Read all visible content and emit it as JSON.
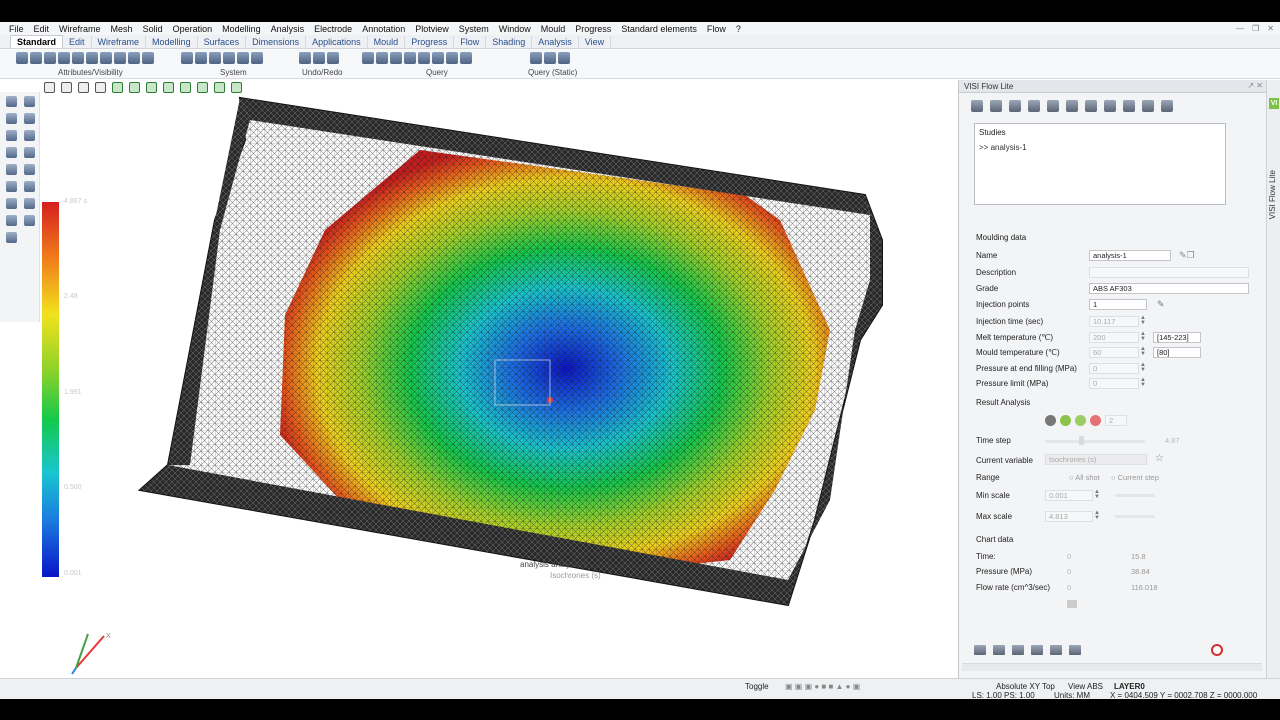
{
  "menu": [
    "File",
    "Edit",
    "Wireframe",
    "Mesh",
    "Solid",
    "Operation",
    "Modelling",
    "Analysis",
    "Electrode",
    "Annotation",
    "Plotview",
    "System",
    "Window",
    "Mould",
    "Progress",
    "Standard elements",
    "Flow",
    "?"
  ],
  "tabs": [
    "Standard",
    "Edit",
    "Wireframe",
    "Modelling",
    "Surfaces",
    "Dimensions",
    "Applications",
    "Mould",
    "Progress",
    "Flow",
    "Shading",
    "Analysis",
    "View"
  ],
  "active_tab": "Standard",
  "ribbon_groups": [
    "Attributes/Visibility",
    "System",
    "Undo/Redo",
    "Query",
    "Query (Static)"
  ],
  "viewport": {
    "legend_ticks": [
      "4.867 s",
      "2.48",
      "1.991",
      "0.500",
      "0.001"
    ],
    "overlay_text": "analysis   analysis-1",
    "overlay_text2": "Isochrones (s)"
  },
  "panel": {
    "title": "VISI Flow Lite",
    "studies_header": "Studies",
    "study_item": ">> analysis-1",
    "moulding_header": "Moulding data",
    "fields": [
      {
        "label": "Name",
        "value": "analysis-1"
      },
      {
        "label": "Description",
        "value": ""
      },
      {
        "label": "Grade",
        "value": "ABS AF303"
      },
      {
        "label": "Injection points",
        "value": "1"
      },
      {
        "label": "Injection time (sec)",
        "value": "10.117"
      },
      {
        "label": "Melt temperature (℃)",
        "value": "200",
        "range": "[145-223]"
      },
      {
        "label": "Mould temperature (℃)",
        "value": "60",
        "range": "[80]"
      },
      {
        "label": "Pressure at end filling (MPa)",
        "value": "0"
      },
      {
        "label": "Pressure limit (MPa)",
        "value": "0"
      }
    ],
    "result_header": "Result Analysis",
    "result_count": "2",
    "time_step_label": "Time step",
    "time_step_value": "4.87",
    "current_variable_label": "Current variable",
    "current_variable_value": "Isochrones (s)",
    "range_label": "Range",
    "range_all": "All shot",
    "range_current": "Current step",
    "min_scale_label": "Min scale",
    "min_scale_value": "0.001",
    "max_scale_label": "Max scale",
    "max_scale_value": "4.813",
    "chart_header": "Chart data",
    "chart_rows": [
      {
        "label": "Time:",
        "v1": "0",
        "v2": "15.8"
      },
      {
        "label": "Pressure (MPa)",
        "v1": "0",
        "v2": "38.84"
      },
      {
        "label": "Flow rate (cm^3/sec)",
        "v1": "0",
        "v2": "116.018"
      }
    ]
  },
  "side_tab": "VISI Flow Lite",
  "status": {
    "toggle": "Toggle",
    "view_mode": "Absolute XY Top",
    "view_abs": "View ABS",
    "layer": "LAYER0",
    "ls": "LS: 1.00 PS: 1.00",
    "units": "Units: MM",
    "coords": "X = 0404.509 Y = 0002.708 Z = 0000.000"
  }
}
